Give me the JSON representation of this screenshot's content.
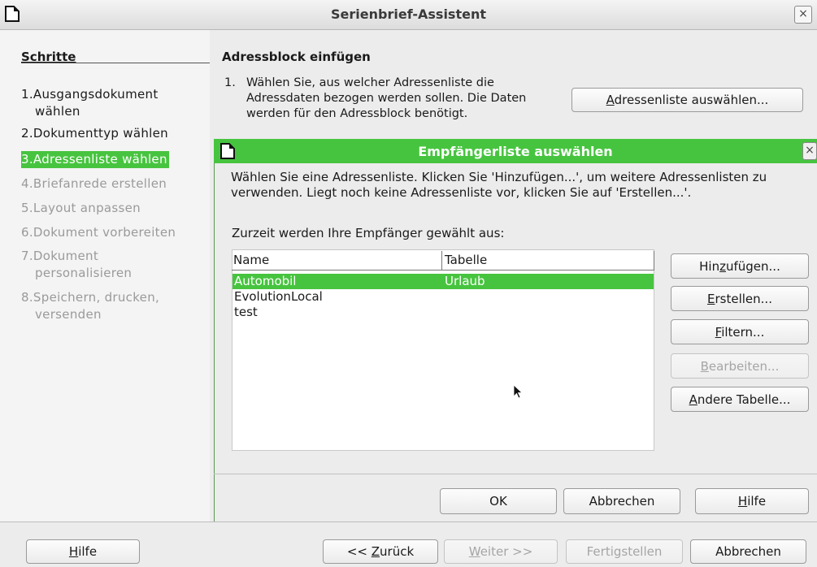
{
  "window": {
    "title": "Serienbrief-Assistent",
    "close": "×"
  },
  "steps": {
    "title": "Schritte",
    "items": [
      {
        "num": "1.",
        "line1": "Ausgangsdokument",
        "line2": "wählen",
        "state": "done"
      },
      {
        "num": "2.",
        "line1": "Dokumenttyp wählen",
        "line2": "",
        "state": "done"
      },
      {
        "num": "3.",
        "line1": "Adressenliste wählen",
        "line2": "",
        "state": "active"
      },
      {
        "num": "4.",
        "line1": "Briefanrede erstellen",
        "line2": "",
        "state": "dim"
      },
      {
        "num": "5.",
        "line1": "Layout anpassen",
        "line2": "",
        "state": "dim"
      },
      {
        "num": "6.",
        "line1": "Dokument vorbereiten",
        "line2": "",
        "state": "dim"
      },
      {
        "num": "7.",
        "line1": "Dokument",
        "line2": "personalisieren",
        "state": "dim"
      },
      {
        "num": "8.",
        "line1": "Speichern, drucken,",
        "line2": "versenden",
        "state": "dim"
      }
    ]
  },
  "main": {
    "title": "Adressblock einfügen",
    "step_num": "1.",
    "step_text": "Wählen Sie, aus welcher Adressenliste die Adressdaten bezogen werden sollen. Die Daten werden für den Adressblock benötigt.",
    "select_list_button": {
      "u": "A",
      "rest": "dressenliste auswählen..."
    }
  },
  "dialog": {
    "title": "Empfängerliste auswählen",
    "close": "×",
    "description": "Wählen Sie eine Adressenliste. Klicken Sie 'Hinzufügen...', um weitere Adressenlisten zu verwenden. Liegt noch keine Adressenliste vor, klicken Sie auf 'Erstellen...'.",
    "current_label": "Zurzeit werden Ihre Empfänger gewählt aus:",
    "columns": [
      "Name",
      "Tabelle"
    ],
    "rows": [
      {
        "name": "Automobil",
        "table": "Urlaub",
        "selected": true
      },
      {
        "name": "EvolutionLocal",
        "table": "",
        "selected": false
      },
      {
        "name": "test",
        "table": "",
        "selected": false
      }
    ],
    "buttons": {
      "add": {
        "pre": "Hin",
        "u": "z",
        "post": "ufügen..."
      },
      "create": {
        "pre": "",
        "u": "E",
        "post": "rstellen..."
      },
      "filter": {
        "pre": "",
        "u": "F",
        "post": "iltern..."
      },
      "edit": {
        "pre": "",
        "u": "B",
        "post": "earbeiten..."
      },
      "other_table": {
        "pre": "",
        "u": "A",
        "post": "ndere Tabelle..."
      },
      "ok": "OK",
      "cancel": "Abbrechen",
      "help": {
        "pre": "",
        "u": "H",
        "post": "ilfe"
      }
    }
  },
  "footer": {
    "help": {
      "u": "H",
      "post": "ilfe"
    },
    "back": {
      "pre": "<< ",
      "u": "Z",
      "post": "urück"
    },
    "next": {
      "u": "W",
      "post": "eiter >>"
    },
    "finish": "Fertigstellen",
    "cancel": "Abbrechen"
  },
  "colors": {
    "accent": "#47c43f",
    "dim_text": "#9a9a9a"
  }
}
